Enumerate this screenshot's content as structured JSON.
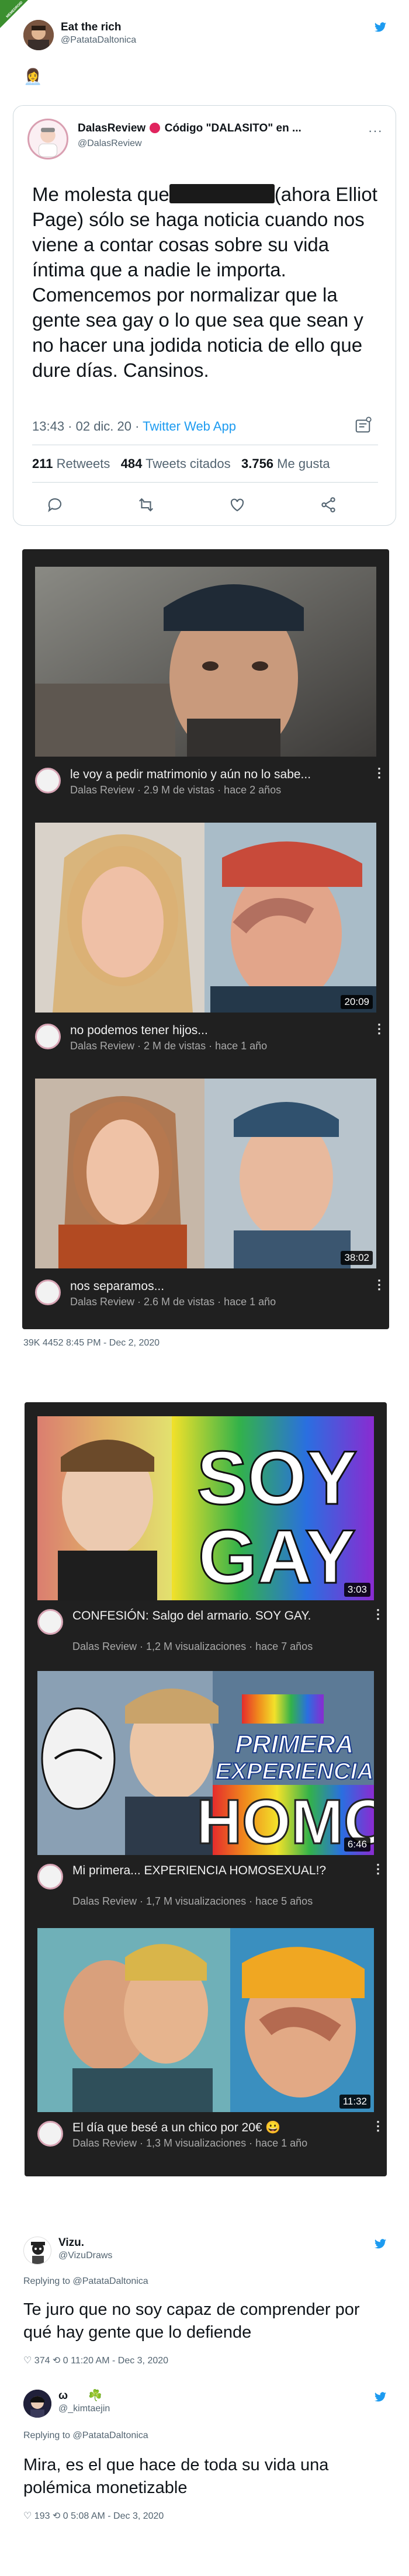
{
  "watermark": {
    "text": "MEMEDROID"
  },
  "top_tweet": {
    "name": "Eat the rich",
    "handle": "@PatataDaltonica",
    "emoji": "👩‍💼"
  },
  "quoted": {
    "name": "DalasReview",
    "name_suffix": "Código \"DALASITO\" en ...",
    "handle": "@DalasReview",
    "text_before_redact": "Me molesta que",
    "text_after_redact": "(ahora Elliot Page) sólo se haga noticia cuando nos viene a contar cosas sobre su vida íntima que a nadie le importa.",
    "text_second": "Comencemos por normalizar que la gente sea gay o lo que sea que sean y no hacer una jodida noticia de ello que dure días. Cansinos.",
    "time": "13:43 · 02 dic. 20 · ",
    "source": "Twitter Web App",
    "retweets_count": "211",
    "retweets_label": "Retweets",
    "quotes_count": "484",
    "quotes_label": "Tweets citados",
    "likes_count": "3.756",
    "likes_label": "Me gusta"
  },
  "panel1": {
    "videos": [
      {
        "title": "le voy a pedir matrimonio y aún no lo sabe...",
        "sub": "Dalas Review · 2.9 M de vistas · hace 2 años",
        "duration": ""
      },
      {
        "title": "no podemos tener hijos...",
        "sub": "Dalas Review · 2 M de vistas · hace 1 año",
        "duration": "20:09"
      },
      {
        "title": "nos separamos...",
        "sub": "Dalas Review · 2.6 M de vistas · hace 1 año",
        "duration": "38:02"
      }
    ],
    "footer": "39K   4452   8:45 PM - Dec 2, 2020"
  },
  "panel2": {
    "thumb1_text_a": "SOY",
    "thumb1_text_b": "GAY",
    "thumb2_text_a": "PRIMERA",
    "thumb2_text_b": "EXPERIENCIA",
    "thumb2_text_c": "HOMO",
    "videos": [
      {
        "title": "CONFESIÓN: Salgo del armario. SOY GAY.",
        "sub": "Dalas Review · 1,2 M visualizaciones · hace 7 años",
        "duration": "3:03"
      },
      {
        "title": "Mi primera... EXPERIENCIA HOMOSEXUAL!?",
        "sub": "Dalas Review · 1,7 M visualizaciones · hace 5 años",
        "duration": "6:46"
      },
      {
        "title": "El día que besé a un chico por 20€ 😀",
        "sub": "Dalas Review · 1,3 M visualizaciones · hace 1 año",
        "duration": "11:32"
      }
    ]
  },
  "reply1": {
    "name": "Vizu.",
    "handle": "@VizuDraws",
    "replying_to": "Replying to @PatataDaltonica",
    "text": "Te juro que no soy capaz de comprender por qué hay gente que lo defiende",
    "meta": "♡ 374   ⟲ 0   11:20 AM - Dec 3, 2020"
  },
  "reply2": {
    "name": "ω",
    "name_emoji": "☘️",
    "handle": "@_kimtaejin",
    "replying_to": "Replying to @PatataDaltonica",
    "text": "Mira, es el que hace de toda su vida una polémica monetizable",
    "meta": "♡ 193   ⟲ 0   5:08 AM - Dec 3, 2020"
  },
  "colors": {
    "twitter_blue": "#1d9bf0",
    "yt_dark": "#202020",
    "redact": "#1a1a1a"
  }
}
